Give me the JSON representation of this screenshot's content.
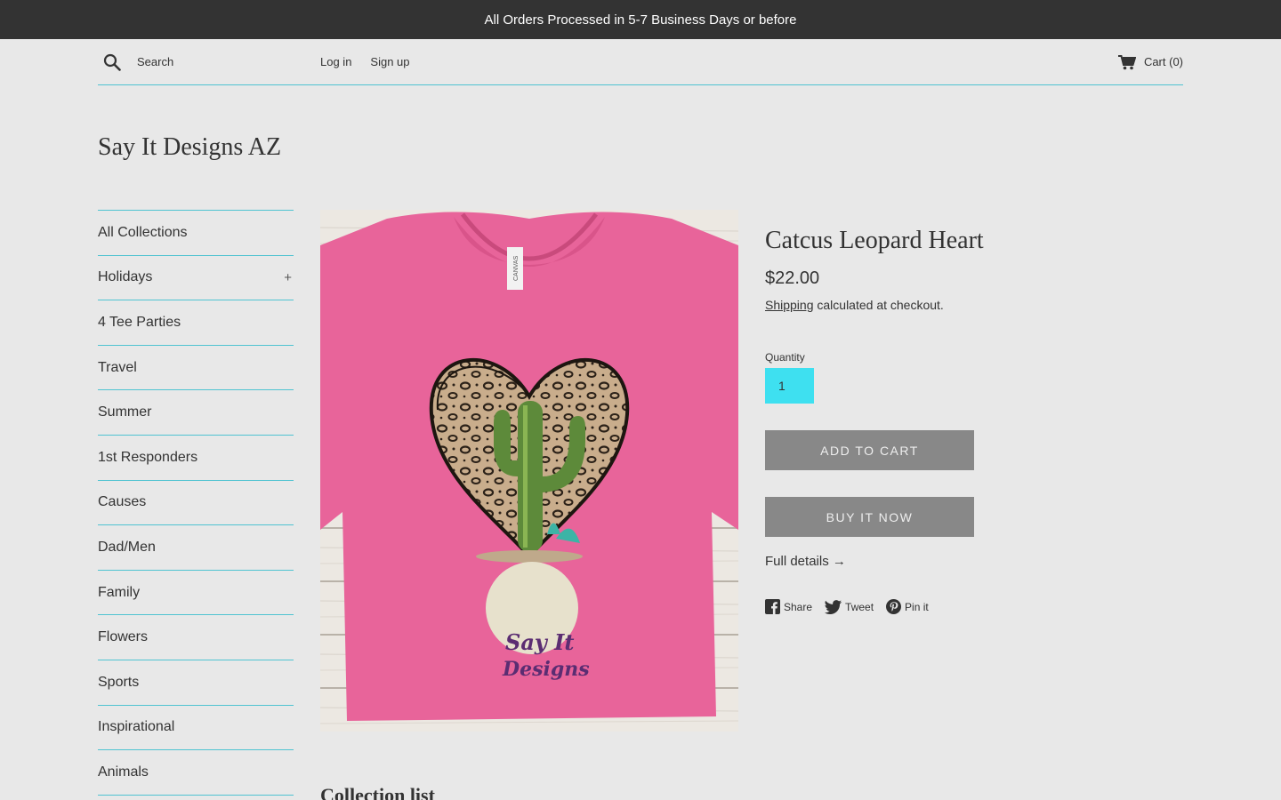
{
  "announcement": "All Orders Processed in 5-7 Business Days or before",
  "header": {
    "search_placeholder": "Search",
    "login": "Log in",
    "signup": "Sign up",
    "cart_label": "Cart (0)"
  },
  "store_name": "Say It Designs AZ",
  "sidebar": {
    "items": [
      {
        "label": "All Collections",
        "expandable": false
      },
      {
        "label": "Holidays",
        "expandable": true,
        "toggle": "+"
      },
      {
        "label": "4 Tee Parties",
        "expandable": false
      },
      {
        "label": "Travel",
        "expandable": false
      },
      {
        "label": "Summer",
        "expandable": false
      },
      {
        "label": "1st Responders",
        "expandable": false
      },
      {
        "label": "Causes",
        "expandable": false
      },
      {
        "label": "Dad/Men",
        "expandable": false
      },
      {
        "label": "Family",
        "expandable": false
      },
      {
        "label": "Flowers",
        "expandable": false
      },
      {
        "label": "Sports",
        "expandable": false
      },
      {
        "label": "Inspirational",
        "expandable": false
      },
      {
        "label": "Animals",
        "expandable": false
      }
    ]
  },
  "product": {
    "title": "Catcus Leopard Heart",
    "price": "$22.00",
    "shipping_link": "Shipping",
    "shipping_text": " calculated at checkout.",
    "quantity_label": "Quantity",
    "quantity_value": "1",
    "add_to_cart": "Add to cart",
    "buy_now": "Buy it now",
    "full_details": "Full details →",
    "image": {
      "watermark_line1": "Say It",
      "watermark_line2": "Designs",
      "tag_text": "CANVAS"
    }
  },
  "social": {
    "share": "Share",
    "tweet": "Tweet",
    "pin": "Pin it"
  },
  "section_heading": "Collection list",
  "colors": {
    "accent_line": "#4fc3d0",
    "quantity_bg": "#3ee0f0",
    "button_bg": "#888888",
    "announcement_bg": "#333333",
    "shirt_pink": "#e8649a"
  }
}
